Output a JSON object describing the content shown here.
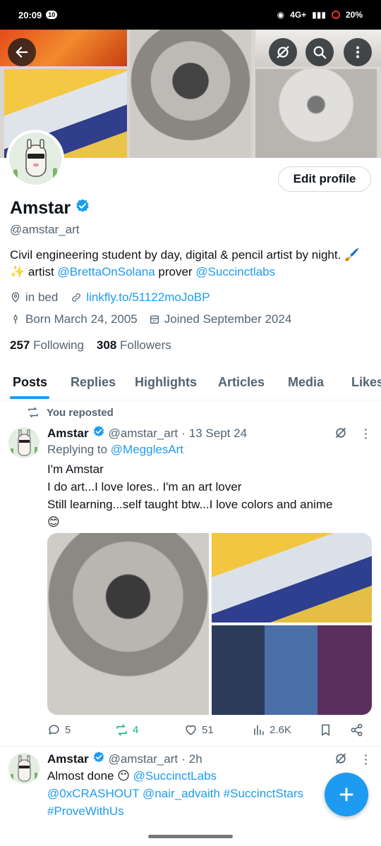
{
  "status_bar": {
    "time": "20:09",
    "notif_badge": "10",
    "network": "4G+",
    "battery": "20%"
  },
  "header": {
    "icons": [
      "back-arrow-icon",
      "grok-icon",
      "search-icon",
      "more-icon"
    ]
  },
  "profile": {
    "name": "Amstar",
    "handle": "@amstar_art",
    "edit_label": "Edit profile",
    "bio_text_1": "Civil engineering student by day, digital & pencil artist by night. 🖌️✨ artist ",
    "bio_mention_1": "@BrettaOnSolana",
    "bio_text_2": " prover ",
    "bio_mention_2": "@Succinctlabs",
    "location": "in bed",
    "website": "linkfly.to/51122moJoBP",
    "birthday": "Born March 24, 2005",
    "joined": "Joined September 2024",
    "following_count": "257",
    "following_label": "Following",
    "followers_count": "308",
    "followers_label": "Followers"
  },
  "tabs": [
    "Posts",
    "Replies",
    "Highlights",
    "Articles",
    "Media",
    "Likes"
  ],
  "posts": [
    {
      "repost_label": "You reposted",
      "name": "Amstar",
      "handle": "@amstar_art",
      "sep": "·",
      "date": "13 Sept 24",
      "replying_prefix": "Replying to ",
      "replying_to": "@MegglesArt",
      "line1": "I'm Amstar",
      "line2": "I do art...I love lores.. I'm an art lover",
      "line3": "Still learning...self taught btw...I love colors and anime",
      "emoji": "😊",
      "replies": "5",
      "reposts": "4",
      "likes": "51",
      "views": "2.6K"
    },
    {
      "name": "Amstar",
      "handle": "@amstar_art",
      "sep": "·",
      "date": "2h",
      "text1": "Almost done 😶 ",
      "mention1": "@SuccinctLabs",
      "mention2": "@0xCRASHOUT",
      "mention3": "@nair_advaith",
      "tag1": "#SuccinctStars",
      "tag2": "#ProveWithUs"
    }
  ],
  "colors": {
    "accent": "#1d9bf0",
    "repost_green": "#00ba7c",
    "text": "#0f1419",
    "secondary": "#536471"
  }
}
